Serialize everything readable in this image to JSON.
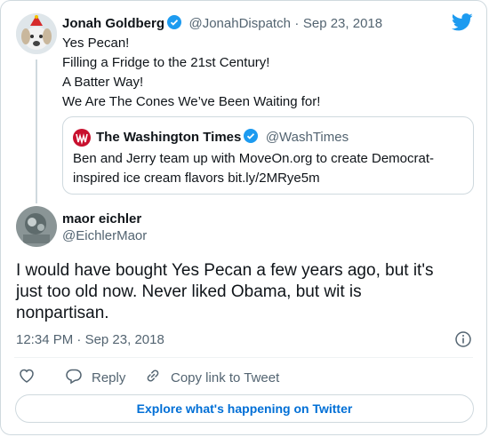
{
  "original_tweet": {
    "author_name": "Jonah Goldberg",
    "handle": "@JonahDispatch",
    "separator": "·",
    "date": "Sep 23, 2018",
    "lines": [
      "Yes Pecan!",
      "Filling a Fridge to the 21st Century!",
      "A Batter Way!",
      "We Are The Cones We’ve Been Waiting for!"
    ]
  },
  "quoted_tweet": {
    "author_name": "The Washington Times",
    "handle": "@WashTimes",
    "text_line1": "Ben and Jerry team up with MoveOn.org to create Democrat-",
    "text_line2": "inspired ice cream flavors bit.ly/2MRye5m"
  },
  "reply_tweet": {
    "author_name": "maor eichler",
    "handle": "@EichlerMaor",
    "lines": [
      "I would have bought Yes Pecan a few years ago, but it's",
      "just too old now. Never liked Obama, but  wit is",
      "nonpartisan."
    ],
    "time": "12:34 PM",
    "separator": "·",
    "date": "Sep 23, 2018"
  },
  "actions": {
    "reply_label": "Reply",
    "copy_link_label": "Copy link to Tweet"
  },
  "explore_label": "Explore what's happening on Twitter",
  "colors": {
    "twitter_blue": "#1d9bf0",
    "text": "#0f1419",
    "muted": "#536471",
    "border": "#cfd9de",
    "washtimes_red": "#c8102e"
  },
  "icons": [
    "twitter-logo-icon",
    "verified-badge-icon",
    "washington-times-logo-icon",
    "info-icon",
    "heart-icon",
    "reply-icon",
    "link-icon"
  ]
}
